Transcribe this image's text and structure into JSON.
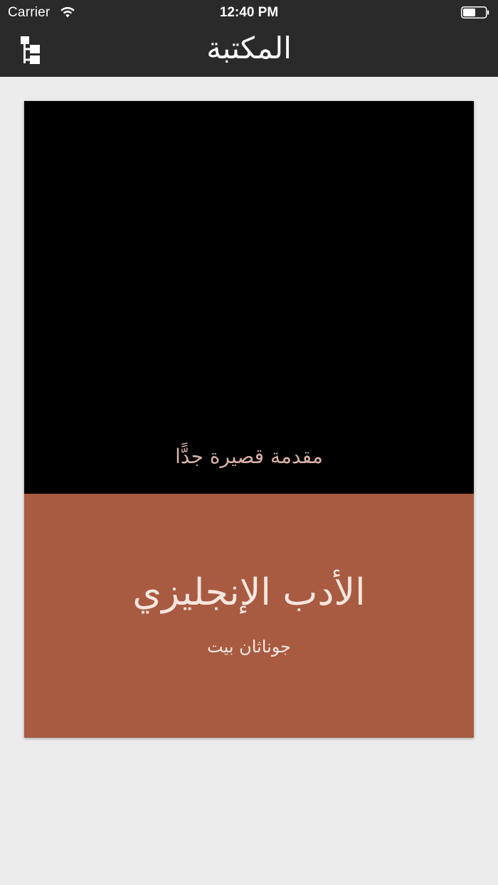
{
  "status_bar": {
    "carrier": "Carrier",
    "time": "12:40 PM",
    "wifi_icon": "wifi-icon",
    "battery_icon": "battery-icon"
  },
  "nav": {
    "title": "المكتبة",
    "left_button_icon": "tree-structure-icon"
  },
  "book": {
    "series": "مقدمة قصيرة جدًّا",
    "title": "الأدب الإنجليزي",
    "author": "جوناثان بيت",
    "colors": {
      "cover_top": "#000000",
      "cover_bottom": "#a85b41",
      "series_text": "#d9b1a4",
      "title_text": "#f6e6e0"
    }
  },
  "colors": {
    "nav_background": "#2a2a2a",
    "page_background": "#ececec"
  }
}
